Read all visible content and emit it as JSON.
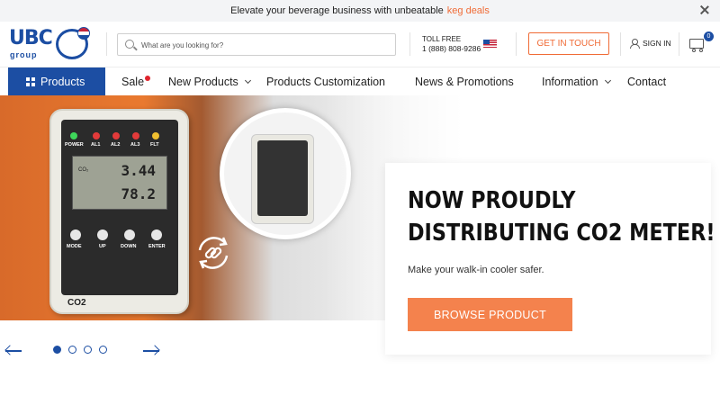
{
  "topbar": {
    "text": "Elevate your beverage business with unbeatable",
    "link": "keg deals"
  },
  "header": {
    "logo_text": "UBC",
    "logo_sub": "group",
    "search_placeholder": "What are you looking for?",
    "toll_label": "TOLL FREE",
    "toll_number": "1 (888) 808-9286",
    "touch_label": "GET IN TOUCH",
    "signin_label": "SIGN IN",
    "cart_count": "0"
  },
  "nav": {
    "products": "Products",
    "items": [
      {
        "label": "Sale"
      },
      {
        "label": "New Products"
      },
      {
        "label": "Products Customization"
      },
      {
        "label": "News & Promotions"
      },
      {
        "label": "Information"
      },
      {
        "label": "Contact"
      }
    ]
  },
  "hero": {
    "device": {
      "leds": [
        "POWER",
        "AL1",
        "AL2",
        "AL3",
        "FLT"
      ],
      "reading1": "3.44",
      "reading2": "78.2",
      "lcd_label": "CO₂",
      "buttons": [
        "MODE",
        "UP",
        "DOWN",
        "ENTER"
      ],
      "tag": "CO2"
    },
    "title_line1": "NOW PROUDLY",
    "title_line2": "DISTRIBUTING CO2 METER!",
    "subtitle": "Make your walk-in cooler safer.",
    "cta": "BROWSE PRODUCT"
  },
  "carousel": {
    "slides": 4,
    "active": 1
  },
  "colors": {
    "brand_blue": "#1c4ea3",
    "accent_orange": "#f06b36",
    "cta_orange": "#f4824d"
  }
}
